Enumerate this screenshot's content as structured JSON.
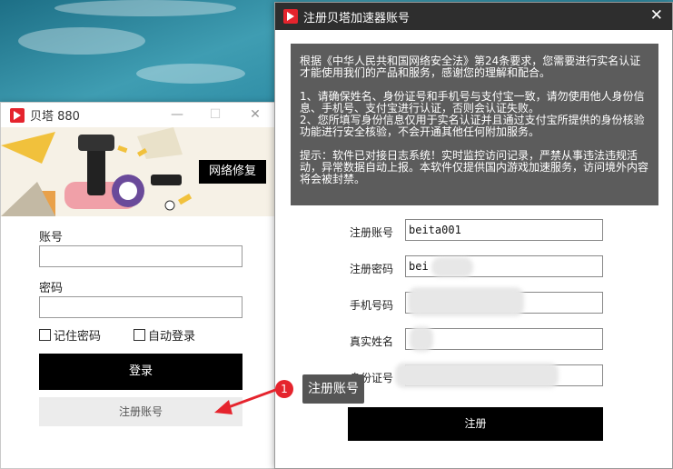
{
  "login_window": {
    "title": "贝塔 880",
    "repair_button": "网络修复",
    "account_label": "账号",
    "password_label": "密码",
    "remember_label": "记住密码",
    "autologin_label": "自动登录",
    "login_button": "登录",
    "register_button": "注册账号"
  },
  "register_window": {
    "title": "注册贝塔加速器账号",
    "notice": [
      "根据《中华人民共和国网络安全法》第24条要求，您需要进行实名认证才能使用我们的产品和服务，感谢您的理解和配合。",
      "1、请确保姓名、身份证号和手机号与支付宝一致，请勿使用他人身份信息、手机号、支付宝进行认证，否则会认证失败。",
      "2、您所填写身份信息仅用于实名认证并且通过支付宝所提供的身份核验功能进行安全核验，不会开通其他任何附加服务。",
      "提示：软件已对接日志系统！实时监控访问记录，严禁从事违法违规活动，异常数据自动上报。本软件仅提供国内游戏加速服务，访问境外内容将会被封禁。"
    ],
    "fields": {
      "account_label": "注册账号",
      "account_value": "beita001",
      "password_label": "注册密码",
      "password_value": "bei",
      "phone_label": "手机号码",
      "name_label": "真实姓名",
      "id_label": "身份证号"
    },
    "submit_button": "注册"
  },
  "annotation": {
    "number": "1",
    "text": "注册账号",
    "color": "#e5242d"
  }
}
